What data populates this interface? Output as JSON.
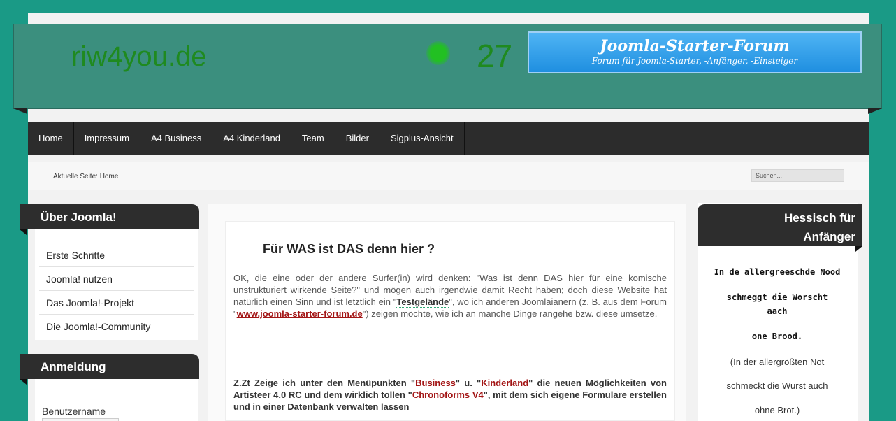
{
  "header": {
    "site_title": "riw4you.de",
    "counter": "27",
    "banner_title": "Joomla-Starter-Forum",
    "banner_subtitle": "Forum für Joomla-Starter, -Anfänger, -Einsteiger"
  },
  "nav": {
    "items": [
      "Home",
      "Impressum",
      "A4 Business",
      "A4 Kinderland",
      "Team",
      "Bilder",
      "Sigplus-Ansicht"
    ]
  },
  "breadcrumb": {
    "text": "Aktuelle Seite: Home"
  },
  "search": {
    "value": "Suchen..."
  },
  "left": {
    "about_title": "Über Joomla!",
    "about_items": [
      "Erste Schritte",
      "Joomla! nutzen",
      "Das Joomla!-Projekt",
      "Die Joomla!-Community"
    ],
    "login_title": "Anmeldung",
    "username_label": "Benutzername"
  },
  "article": {
    "title": "Für WAS ist DAS denn hier ?",
    "p1_a": "OK, die eine oder der andere Surfer(in) wird denken: \"Was ist denn DAS hier für eine komische unstrukturiert wirkende Seite?\" und mögen auch irgendwie damit Recht haben; doch diese Website hat natürlich einen Sinn und ist letztlich ein \"",
    "p1_link1": "Testgelände",
    "p1_b": "\", wo ich anderen Joomlaianern (z. B. aus dem Forum \"",
    "p1_link2": "www.joomla-starter-forum.de",
    "p1_c": "\") zeigen möchte, wie ich an manche Dinge rangehe bzw. diese umsetze.",
    "p2_zzt": "Z.Zt",
    "p2_a": " Zeige ich unter den Menüpunkten \"",
    "p2_link1": "Business",
    "p2_b": "\" u. \"",
    "p2_link2": "Kinderland",
    "p2_c": "\" die neuen Möglichkeiten von Artisteer 4.0 RC und dem wirklich tollen \"",
    "p2_link3": "Chronoforms V4",
    "p2_d": "\", mit dem sich eigene Formulare erstellen und in einer Datenbank verwalten lassen"
  },
  "right": {
    "title_line1": "Hessisch für",
    "title_line2": "Anfänger",
    "line1": "In de allergreeschde Nood",
    "line2": "schmeggt die Worscht",
    "line3": "aach",
    "line4": "one Brood.",
    "line5": "(In der allergrößten Not",
    "line6": "schmeckt die Wurst auch",
    "line7": "ohne Brot.)"
  },
  "colors": {
    "background": "#1a9a86",
    "header": "#3b8f7e",
    "title_green": "#1f8a1f",
    "nav": "#2c2c2c",
    "link_red": "#a31515"
  }
}
